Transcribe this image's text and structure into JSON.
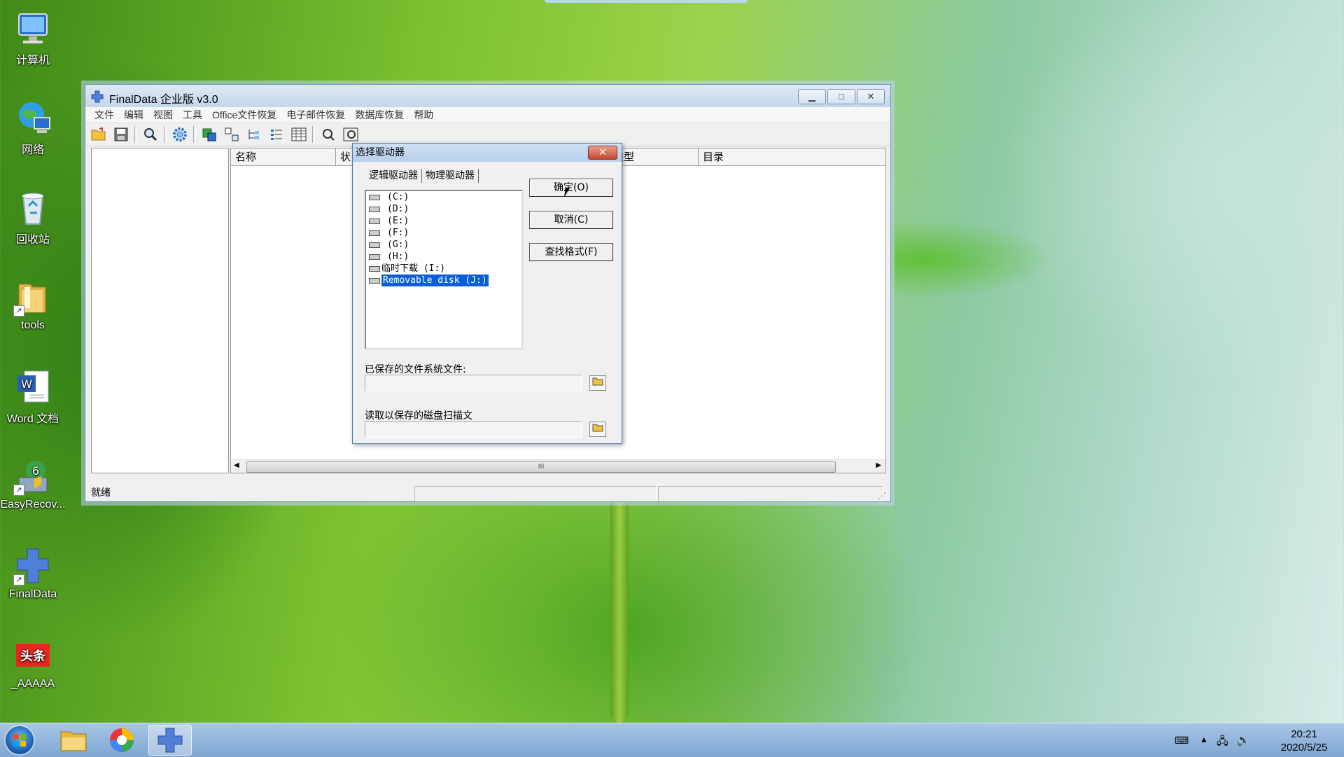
{
  "desktop": {
    "icons": [
      {
        "label": "计算机",
        "icon": "computer-icon"
      },
      {
        "label": "网络",
        "icon": "network-icon"
      },
      {
        "label": "回收站",
        "icon": "recycle-bin-icon"
      },
      {
        "label": "tools",
        "icon": "folder-icon"
      },
      {
        "label": "Word 文档",
        "icon": "word-doc-icon"
      },
      {
        "label": "EasyRecov...",
        "icon": "easyrecovery-icon"
      },
      {
        "label": "FinalData",
        "icon": "finaldata-icon"
      },
      {
        "label": "_AAAAA",
        "icon": "toutiao-icon",
        "logo_text": "头条"
      }
    ]
  },
  "window": {
    "title": "FinalData 企业版 v3.0",
    "controls": {
      "minimize": "▁",
      "maximize": "□",
      "close": "✕"
    },
    "menu": [
      "文件",
      "编辑",
      "视图",
      "工具",
      "Office文件恢复",
      "电子邮件恢复",
      "数据库恢复",
      "帮助"
    ],
    "columns": [
      "名称",
      "状",
      "类型",
      "目录"
    ],
    "scroll_grip": "III",
    "status": "就绪"
  },
  "dialog": {
    "title": "选择驱动器",
    "close": "✕",
    "tabs": [
      "逻辑驱动器",
      "物理驱动器"
    ],
    "drives": [
      "(C:)",
      "(D:)",
      "(E:)",
      "(F:)",
      "(G:)",
      "(H:)",
      "临时下载 (I:)",
      "Removable disk (J:)"
    ],
    "selected_drive": "Removable disk (J:)",
    "ok": "确定(O)",
    "cancel": "取消(C)",
    "find_format": "查找格式(F)",
    "saved_fs_label": "已保存的文件系统文件:",
    "read_scan_label": "读取以保存的磁盘扫描文"
  },
  "taskbar": {
    "time": "20:21",
    "date": "2020/5/25"
  },
  "colors": {
    "selection": "#0a5fd8",
    "taskbar": "#7ea6d1",
    "close_red": "#c74632"
  }
}
